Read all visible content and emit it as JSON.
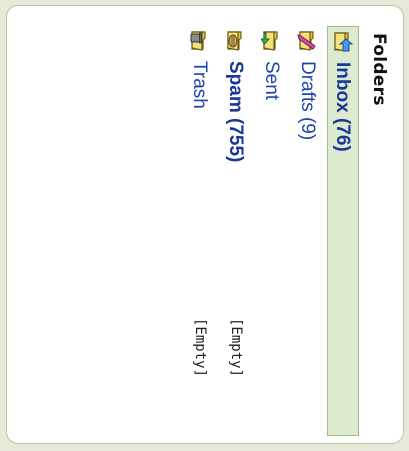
{
  "panel": {
    "title": "Folders"
  },
  "folders": [
    {
      "id": "inbox",
      "label": "Inbox (76)",
      "icon": "inbox-icon",
      "selected": true,
      "bold": true,
      "action": ""
    },
    {
      "id": "drafts",
      "label": "Drafts (9)",
      "icon": "drafts-icon",
      "selected": false,
      "bold": false,
      "action": ""
    },
    {
      "id": "sent",
      "label": "Sent",
      "icon": "sent-icon",
      "selected": false,
      "bold": false,
      "action": ""
    },
    {
      "id": "spam",
      "label": "Spam (755)",
      "icon": "spam-icon",
      "selected": false,
      "bold": true,
      "action": "[Empty]"
    },
    {
      "id": "trash",
      "label": "Trash",
      "icon": "trash-icon",
      "selected": false,
      "bold": false,
      "action": "[Empty]"
    }
  ],
  "colors": {
    "background": "#e6ead9",
    "selected_row": "#dcebcf",
    "link": "#1b3aa8",
    "folder_yellow": "#f2dc5a"
  }
}
